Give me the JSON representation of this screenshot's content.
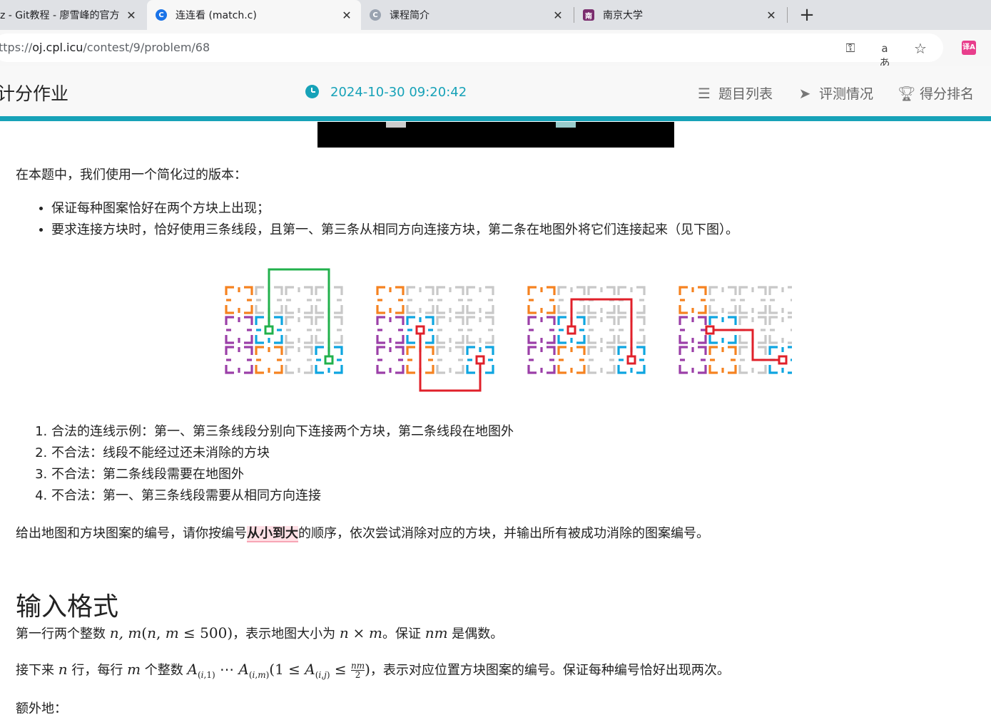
{
  "tabs": [
    {
      "title": "z - Git教程 - 廖雪峰的官方",
      "active": false
    },
    {
      "title": "连连看 (match.c)",
      "active": true
    },
    {
      "title": "课程简介",
      "active": false
    },
    {
      "title": "南京大学",
      "active": false
    }
  ],
  "address": {
    "url_prefix": "ttps://",
    "host": "oj.cpl.icu",
    "path": "/contest/9/problem/68"
  },
  "site": {
    "title": "计分作业",
    "time": "2024-10-30 09:20:42",
    "nav": [
      "题目列表",
      "评测情况",
      "得分排名"
    ]
  },
  "problem": {
    "intro": "在本题中，我们使用一个简化过的版本：",
    "rules": [
      "保证每种图案恰好在两个方块上出现；",
      "要求连接方块时，恰好使用三条线段，且第一、第三条从相同方向连接方块，第二条在地图外将它们连接起来（见下图）。"
    ],
    "figure_items": [
      "合法的连线示例：第一、第三条线段分别向下连接两个方块，第二条线段在地图外",
      "不合法：线段不能经过还未消除的方块",
      "不合法：第二条线段需要在地图外",
      "不合法：第一、第三条线段需要从相同方向连接"
    ],
    "task_before": "给出地图和方块图案的编号，请你按编号",
    "task_highlight": "从小到大",
    "task_after": "的顺序，依次尝试消除对应的方块，并输出所有被成功消除的图案编号。",
    "input_heading": "输入格式",
    "line1_a": "第一行两个整数",
    "line1_b": "，表示地图大小为",
    "line1_c": "。保证",
    "line1_d": "是偶数。",
    "line2_a": "接下来",
    "line2_b": "行，每行",
    "line2_c": "个整数",
    "line2_d": "，表示对应位置方块图案的编号。保证每种编号恰好出现两次。",
    "extra": "额外地："
  },
  "colors": {
    "accent": "#17a2b8",
    "orange": "#f58220",
    "purple": "#9b3fa8",
    "blue": "#0ea5e0",
    "green": "#22b14c",
    "red": "#e0202a",
    "gray": "#c8c8c8"
  }
}
